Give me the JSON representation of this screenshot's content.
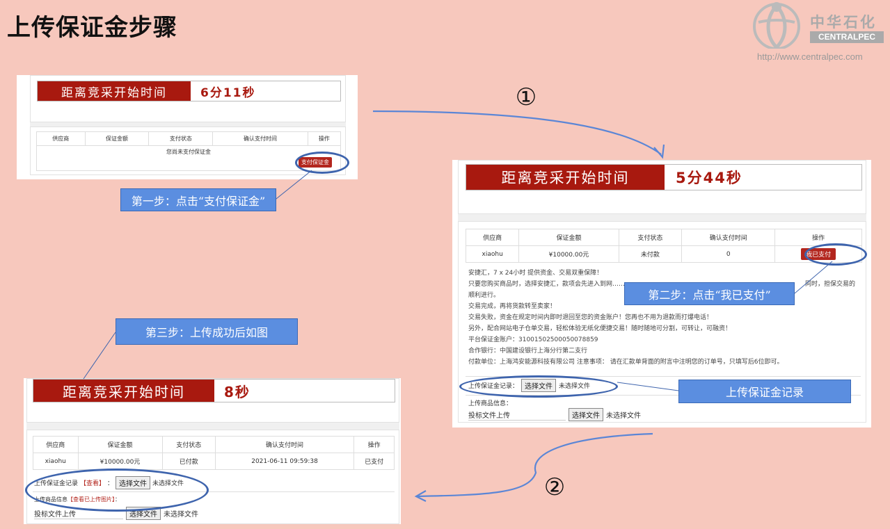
{
  "slide": {
    "title": "上传保证金步骤",
    "logo": {
      "cn": "中华石化",
      "en": "CENTRALPEC",
      "url": "http://www.centralpec.com"
    },
    "step_numbers": [
      "①",
      "②"
    ]
  },
  "shot1": {
    "timer_label": "距离竞采开始时间",
    "timer_value": "6分11秒",
    "headers": [
      "供应商",
      "保证金额",
      "支付状态",
      "确认支付时间",
      "操作"
    ],
    "empty_msg": "您尚未支付保证金",
    "pay_button": "支付保证金"
  },
  "shot2": {
    "timer_label": "距离竞采开始时间",
    "timer_value": "5分44秒",
    "headers": [
      "供应商",
      "保证金额",
      "支付状态",
      "确认支付时间",
      "操作"
    ],
    "row": {
      "supplier": "xiaohu",
      "amount": "¥10000.00元",
      "status": "未付款",
      "time": "0",
      "action": "我已支付"
    },
    "info_lines": [
      "安捷汇，7 x 24小时 提供资金、交易双重保障！",
      "只要您购买商品时，选择安捷汇，款项会先进入到网……",
      "顺利进行。",
      "交易完成，再将货款转至卖家！",
      "交易失败，资金在规定时间内即时退回至您的资金账户！您再也不用为退款而打爆电话！",
      "另外，配合网站电子仓单交易，轻松体验无纸化便捷交易！随时随地可分割，可转让，可融资！",
      "平台保证金账户：31001502500050078859",
      "合作银行：中国建设银行上海分行第二支行",
      "付款单位：上海鸿安能源科技有限公司 注意事项： 请在汇款单背面的附言中注明您的订单号，只填写后6位即可。"
    ],
    "info_line2_tail": "同时，担保交易的",
    "upload_label": "上传保证金记录：",
    "choose_file": "选择文件",
    "no_file": "未选择文件",
    "goods_label": "上传商品信息：",
    "goods_input": "投标文件上传"
  },
  "shot3": {
    "timer_label": "距离竞采开始时间",
    "timer_value": "8秒",
    "headers": [
      "供应商",
      "保证金额",
      "支付状态",
      "确认支付时间",
      "操作"
    ],
    "row": {
      "supplier": "xiaohu",
      "amount": "¥10000.00元",
      "status": "已付款",
      "time": "2021-06-11 09:59:38",
      "action": "已支付"
    },
    "upload_label": "上传保证金记录",
    "view_link": "【查看】",
    "colon": "：",
    "choose_file": "选择文件",
    "no_file": "未选择文件",
    "goods_label": "上传商品信息",
    "goods_link": "【查看已上传图片】",
    "goods_input": "投标文件上传"
  },
  "callouts": {
    "step1": "第一步：点击“支付保证金”",
    "step2": "第二步：点击“我已支付”",
    "step3": "第三步：上传成功后如图",
    "upload": "上传保证金记录"
  },
  "colors": {
    "background": "#f7c8bd",
    "brand_red": "#a8190f",
    "callout_blue": "#5b8ee0",
    "arrow_blue": "#5b86d6"
  }
}
